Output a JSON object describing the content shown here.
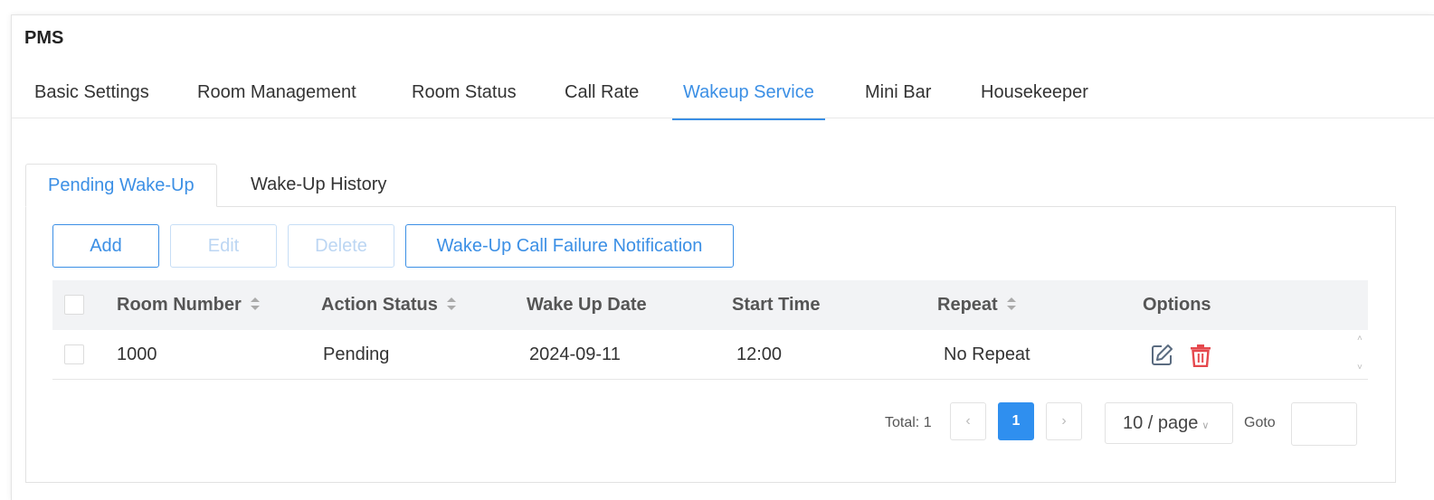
{
  "app": {
    "title": "PMS"
  },
  "main_tabs": [
    {
      "label": "Basic Settings"
    },
    {
      "label": "Room Management"
    },
    {
      "label": "Room Status"
    },
    {
      "label": "Call Rate"
    },
    {
      "label": "Wakeup Service",
      "active": true
    },
    {
      "label": "Mini Bar"
    },
    {
      "label": "Housekeeper"
    }
  ],
  "sub_tabs": [
    {
      "label": "Pending Wake-Up",
      "active": true
    },
    {
      "label": "Wake-Up History"
    }
  ],
  "toolbar": {
    "add_label": "Add",
    "edit_label": "Edit",
    "delete_label": "Delete",
    "failure_notification_label": "Wake-Up Call Failure Notification"
  },
  "table": {
    "columns": [
      "Room Number",
      "Action Status",
      "Wake Up Date",
      "Start Time",
      "Repeat",
      "Options"
    ],
    "rows": [
      {
        "room_number": "1000",
        "action_status": "Pending",
        "wake_up_date": "2024-09-11",
        "start_time": "12:00",
        "repeat": "No Repeat"
      }
    ]
  },
  "pagination": {
    "total_label": "Total: 1",
    "current_page": "1",
    "page_size": "10 / page",
    "goto_label": "Goto",
    "goto_value": ""
  },
  "colors": {
    "accent": "#3b8fe5",
    "delete_icon": "#e5484d",
    "edit_icon": "#5a6b80"
  }
}
